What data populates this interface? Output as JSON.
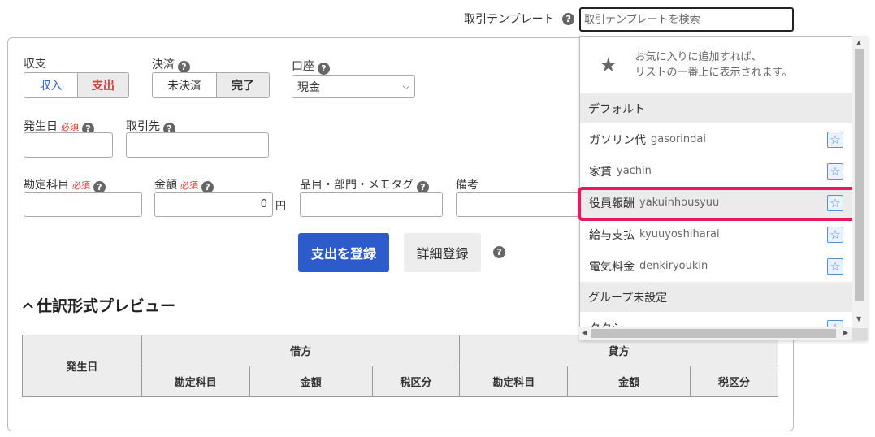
{
  "template_search": {
    "label": "取引テンプレート",
    "placeholder": "取引テンプレートを検索"
  },
  "form": {
    "type_label": "収支",
    "type_options": [
      "収入",
      "支出"
    ],
    "type_selected": "支出",
    "settlement_label": "決済",
    "settlement_options": [
      "未決済",
      "完了"
    ],
    "settlement_selected": "完了",
    "account_label": "口座",
    "account_value": "現金",
    "date_label": "発生日",
    "required": "必須",
    "partner_label": "取引先",
    "category_label": "勘定科目",
    "amount_label": "金額",
    "amount_value": "0",
    "amount_unit": "円",
    "item_label": "品目・部門・メモタグ",
    "note_label": "備考",
    "submit_label": "支出を登録",
    "detail_label": "詳細登録"
  },
  "preview": {
    "title": "仕訳形式プレビュー",
    "headers": {
      "date": "発生日",
      "debit": "借方",
      "credit": "貸方",
      "account": "勘定科目",
      "amount": "金額",
      "tax": "税区分"
    }
  },
  "dropdown": {
    "fav_hint_line1": "お気に入りに追加すれば、",
    "fav_hint_line2": "リストの一番上に表示されます。",
    "groups": [
      {
        "name": "デフォルト",
        "items": [
          {
            "name": "ガソリン代",
            "romaji": "gasorindai"
          },
          {
            "name": "家賃",
            "romaji": "yachin"
          },
          {
            "name": "役員報酬",
            "romaji": "yakuinhousyuu"
          },
          {
            "name": "給与支払",
            "romaji": "kyuuyoshiharai"
          },
          {
            "name": "電気料金",
            "romaji": "denkiryoukin"
          }
        ]
      },
      {
        "name": "グループ未設定",
        "items": [
          {
            "name": "タクシー",
            "romaji": ""
          }
        ]
      }
    ],
    "highlighted_item": "役員報酬"
  },
  "icons": {
    "help": "?",
    "star": "★",
    "fav_star": "☆"
  },
  "colors": {
    "primary": "#2e5bcc",
    "highlight": "#e8195e",
    "required": "#dd3333"
  }
}
